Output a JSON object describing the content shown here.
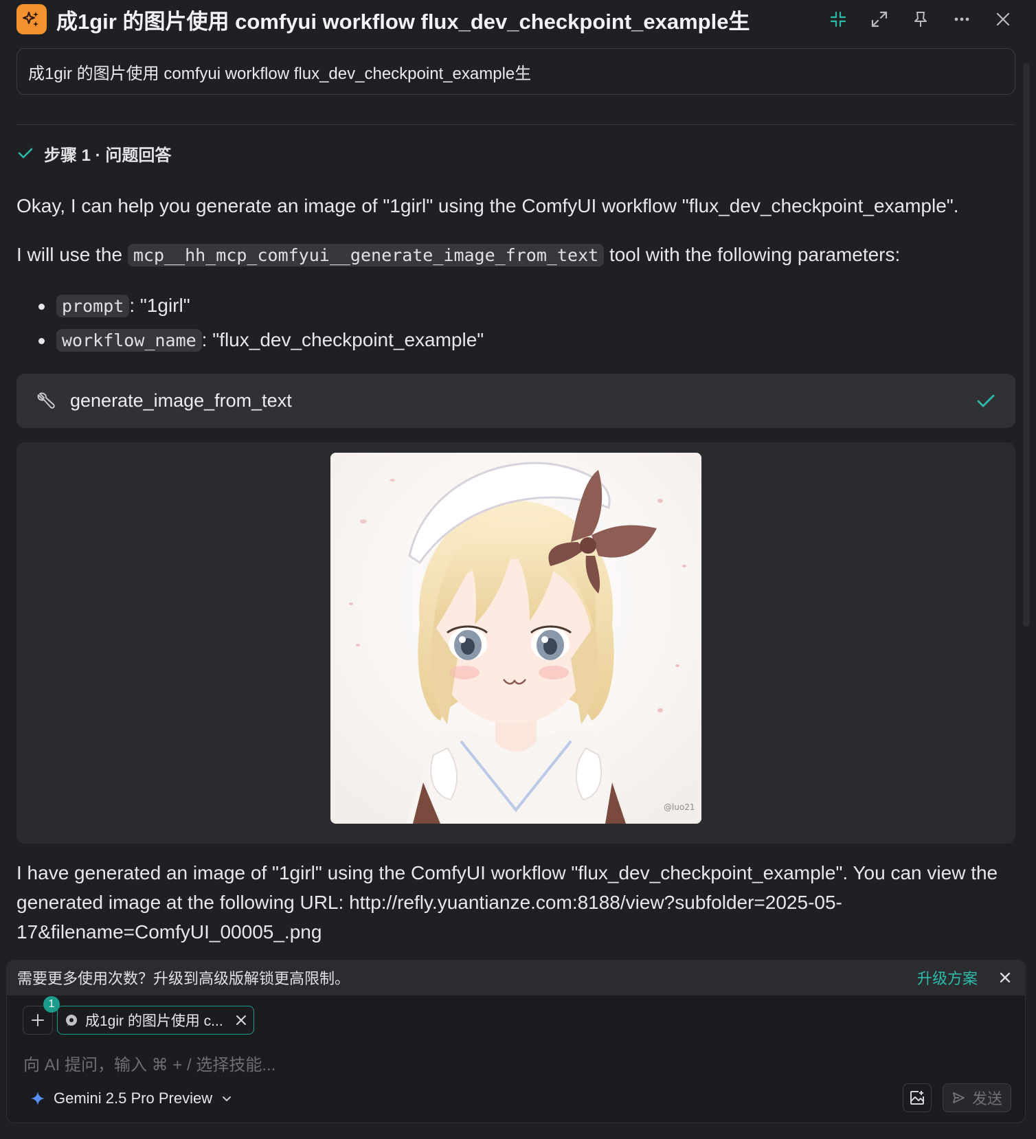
{
  "header": {
    "title": "成1gir 的图片使用 comfyui workflow flux_dev_checkpoint_example生",
    "icons": [
      "sparkles-icon",
      "minimize-icon",
      "expand-icon",
      "pin-icon",
      "more-icon",
      "close-icon"
    ]
  },
  "query": {
    "text": "成1gir 的图片使用 comfyui workflow flux_dev_checkpoint_example生"
  },
  "step": {
    "label": "步骤 1 · 问题回答"
  },
  "response": {
    "intro": "Okay, I can help you generate an image of \"1girl\" using the ComfyUI workflow \"flux_dev_checkpoint_example\".",
    "tool_sentence_prefix": "I will use the",
    "tool_code": "mcp__hh_mcp_comfyui__generate_image_from_text",
    "tool_sentence_suffix": "tool with the following parameters:",
    "params": [
      {
        "key": "prompt",
        "value": ": \"1girl\""
      },
      {
        "key": "workflow_name",
        "value": ": \"flux_dev_checkpoint_example\""
      }
    ],
    "tool_call": {
      "name": "generate_image_from_text",
      "status": "done"
    },
    "image": {
      "description": "anime-girl-image",
      "signature": "@luo21"
    },
    "result": "I have generated an image of \"1girl\" using the ComfyUI workflow \"flux_dev_checkpoint_example\". You can view the generated image at the following URL: http://refly.yuantianze.com:8188/view?subfolder=2025-05-17&filename=ComfyUI_00005_.png"
  },
  "notice": {
    "text": "需要更多使用次数？升级到高级版解锁更高限制。",
    "upgrade_label": "升级方案"
  },
  "composer": {
    "context_count": "1",
    "context_chip": "成1gir 的图片使用 c...",
    "placeholder": "向 AI 提问，输入 ⌘ + / 选择技能...",
    "model": "Gemini 2.5 Pro Preview",
    "send_label": "发送"
  },
  "colors": {
    "background": "#1f2023",
    "accent": "#1b9c8d",
    "brand_icon": "#f3922e",
    "check": "#2dbaa8"
  }
}
